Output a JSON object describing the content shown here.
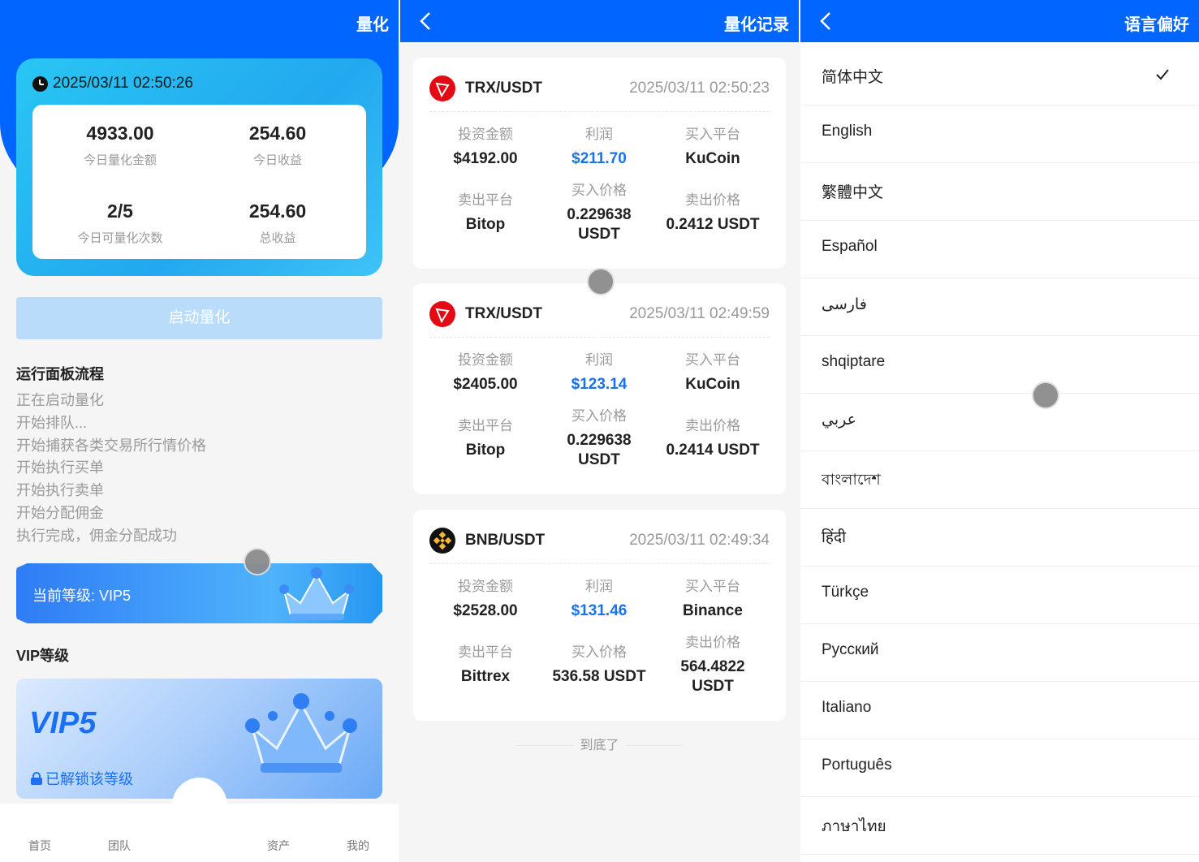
{
  "screen1": {
    "title": "量化",
    "datetime": "2025/03/11 02:50:26",
    "stats": [
      {
        "value": "4933.00",
        "label": "今日量化金额"
      },
      {
        "value": "254.60",
        "label": "今日收益"
      },
      {
        "value": "2/5",
        "label": "今日可量化次数"
      },
      {
        "value": "254.60",
        "label": "总收益"
      }
    ],
    "start_button": "启动量化",
    "flow_title": "运行面板流程",
    "flow_steps": [
      "正在启动量化",
      "开始排队...",
      "开始捕获各类交易所行情价格",
      "开始执行买单",
      "开始执行卖单",
      "开始分配佣金",
      "执行完成，佣金分配成功"
    ],
    "current_level": "当前等级: VIP5",
    "vip_title": "VIP等级",
    "vip_card": {
      "name": "VIP5",
      "status": "已解锁该等级"
    },
    "tabs": [
      "首页",
      "团队",
      "资产",
      "我的"
    ],
    "accent": "#0066ff"
  },
  "screen2": {
    "title": "量化记录",
    "labels": {
      "invest": "投资金额",
      "profit": "利润",
      "buy_platform": "买入平台",
      "sell_platform": "卖出平台",
      "buy_price": "买入价格",
      "sell_price": "卖出价格"
    },
    "records": [
      {
        "coin_icon": "tron-icon",
        "pair": "TRX/USDT",
        "time": "2025/03/11 02:50:23",
        "invest": "$4192.00",
        "profit": "$211.70",
        "buy_platform": "KuCoin",
        "sell_platform": "Bitop",
        "buy_price": "0.229638 USDT",
        "sell_price": "0.2412 USDT"
      },
      {
        "coin_icon": "tron-icon",
        "pair": "TRX/USDT",
        "time": "2025/03/11 02:49:59",
        "invest": "$2405.00",
        "profit": "$123.14",
        "buy_platform": "KuCoin",
        "sell_platform": "Bitop",
        "buy_price": "0.229638 USDT",
        "sell_price": "0.2414 USDT"
      },
      {
        "coin_icon": "bnb-icon",
        "pair": "BNB/USDT",
        "time": "2025/03/11 02:49:34",
        "invest": "$2528.00",
        "profit": "$131.46",
        "buy_platform": "Binance",
        "sell_platform": "Bittrex",
        "buy_price": "536.58 USDT",
        "sell_price": "564.4822 USDT"
      }
    ],
    "end_text": "到底了",
    "profit_color": "#1a73e8"
  },
  "screen3": {
    "title": "语言偏好",
    "selected": "简体中文",
    "languages": [
      "简体中文",
      "English",
      "繁體中文",
      "Español",
      "فارسی",
      "shqiptare",
      "عربي",
      "বাংলাদেশ",
      "हिंदी",
      "Türkçe",
      "Русский",
      "Italiano",
      "Português",
      "ภาษาไทย"
    ]
  }
}
